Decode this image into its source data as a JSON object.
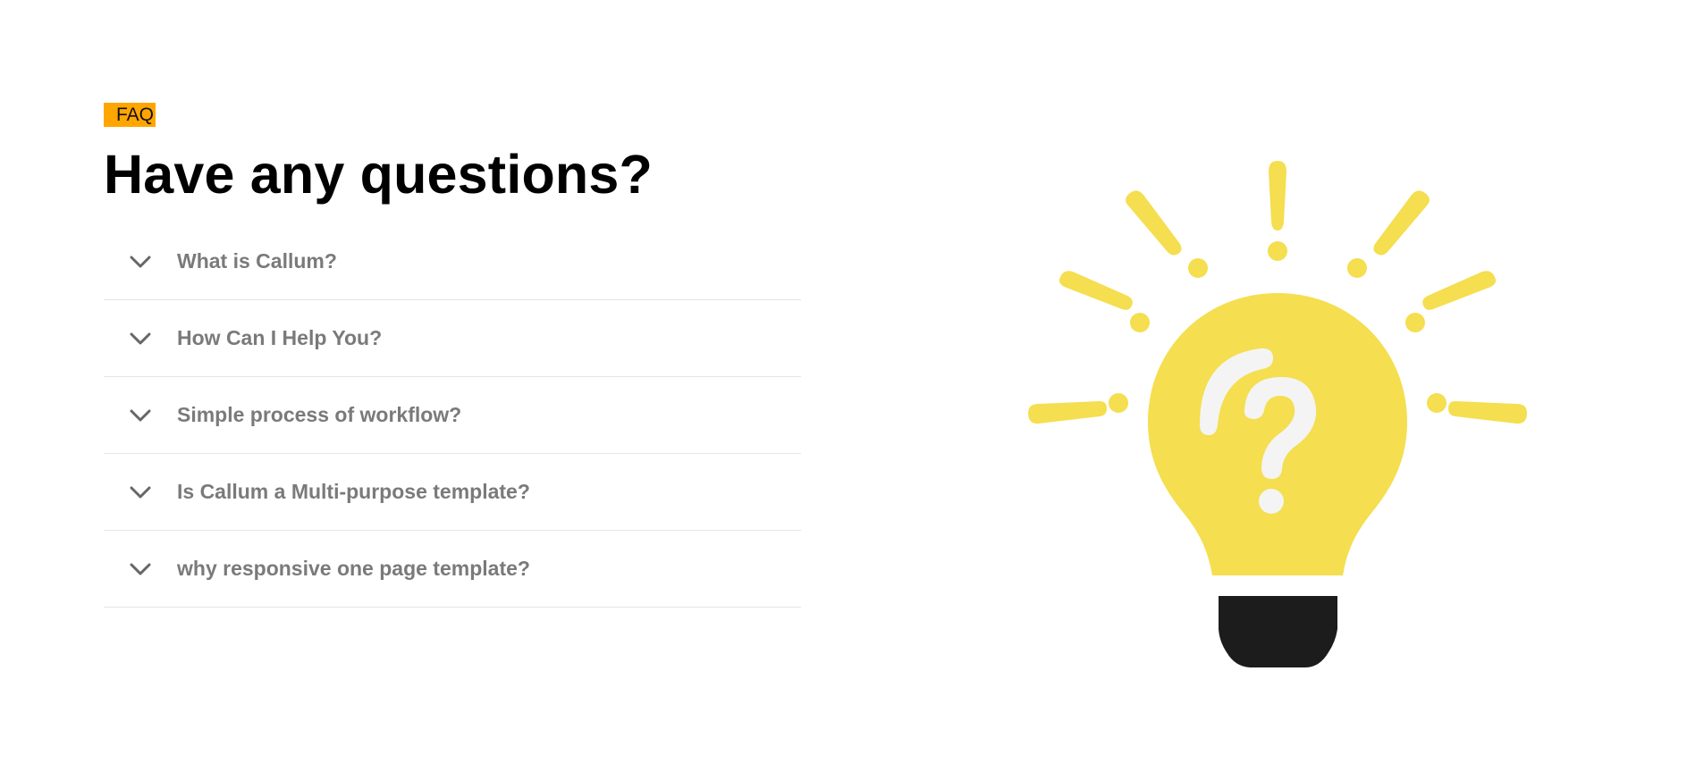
{
  "faq": {
    "tag": "FAQ",
    "title": "Have any questions?",
    "items": [
      {
        "question": "What is Callum?"
      },
      {
        "question": "How Can I Help You?"
      },
      {
        "question": "Simple process of workflow?"
      },
      {
        "question": "Is Callum a Multi-purpose template?"
      },
      {
        "question": "why responsive one page template?"
      }
    ]
  },
  "icons": {
    "toggle": "chevron-down-icon",
    "illustration": "lightbulb-question-icon"
  },
  "colors": {
    "tag_background": "#ffa500",
    "bulb": "#f5de4f",
    "bulb_base": "#1c1c1c",
    "question_text": "#7a7a7a"
  }
}
